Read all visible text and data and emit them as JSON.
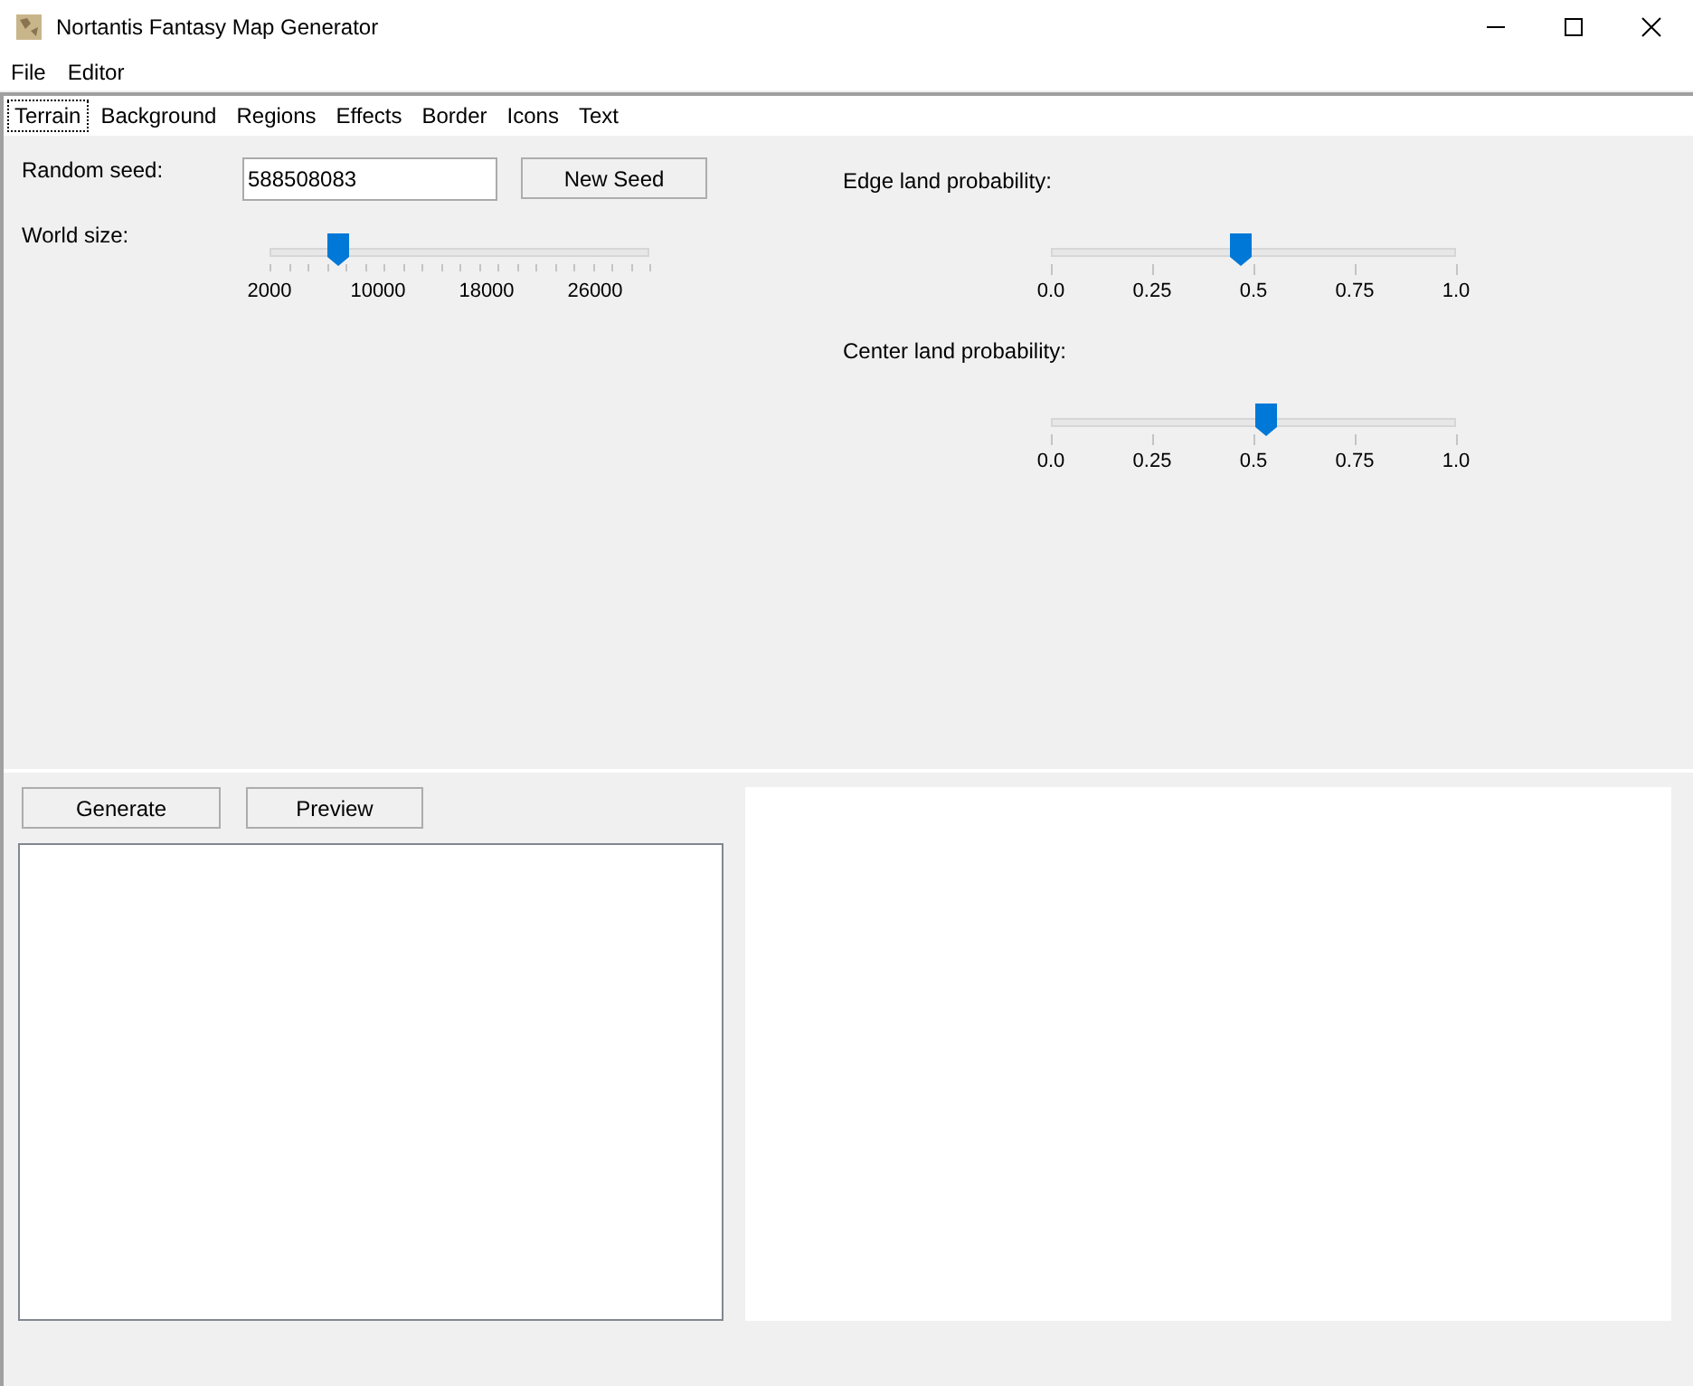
{
  "window": {
    "title": "Nortantis Fantasy Map Generator"
  },
  "menu": [
    "File",
    "Editor"
  ],
  "tabs": [
    {
      "label": "Terrain",
      "selected": true
    },
    {
      "label": "Background",
      "selected": false
    },
    {
      "label": "Regions",
      "selected": false
    },
    {
      "label": "Effects",
      "selected": false
    },
    {
      "label": "Border",
      "selected": false
    },
    {
      "label": "Icons",
      "selected": false
    },
    {
      "label": "Text",
      "selected": false
    }
  ],
  "random_seed": {
    "label": "Random seed:",
    "value": "588508083",
    "button": "New Seed"
  },
  "world_size": {
    "label": "World size:",
    "level": 0.18,
    "tick_labels": [
      "2000",
      "10000",
      "18000",
      "26000"
    ]
  },
  "edge_land_probability": {
    "label": "Edge land probability:",
    "level": 0.47,
    "tick_labels": [
      "0.0",
      "0.25",
      "0.5",
      "0.75",
      "1.0"
    ]
  },
  "center_land_probability": {
    "label": "Center land probability:",
    "level": 0.53,
    "tick_labels": [
      "0.0",
      "0.25",
      "0.5",
      "0.75",
      "1.0"
    ]
  },
  "buttons": [
    "Generate",
    "Preview"
  ]
}
